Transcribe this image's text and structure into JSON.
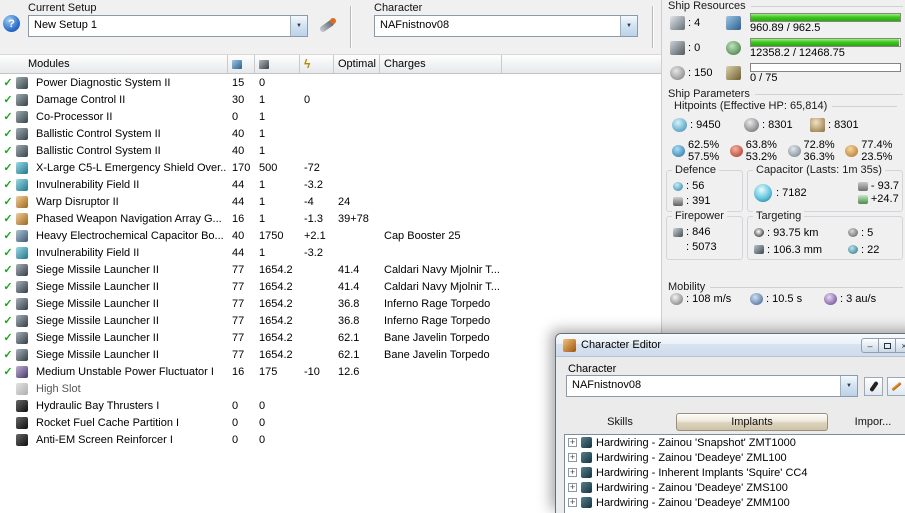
{
  "icons": {
    "help": "?",
    "dropdown_arrow": "▼",
    "check": "✓",
    "lightning": "ϟ",
    "expand": "+",
    "minimize": "–",
    "close": "×"
  },
  "toolbar": {
    "current_setup_label": "Current Setup",
    "setup_value": "New Setup 1",
    "character_label": "Character",
    "character_value": "NAFnistnov08"
  },
  "modules": {
    "title": "Modules",
    "optimal_header": "Optimal",
    "charges_header": "Charges",
    "rows": [
      {
        "check": true,
        "icon": "module",
        "name": "Power Diagnostic System II",
        "cpu": "15",
        "pg": "0",
        "cap": "",
        "optimal": "",
        "charges": ""
      },
      {
        "check": true,
        "icon": "module",
        "name": "Damage Control II",
        "cpu": "30",
        "pg": "1",
        "cap": "0",
        "optimal": "",
        "charges": ""
      },
      {
        "check": true,
        "icon": "module",
        "name": "Co-Processor II",
        "cpu": "0",
        "pg": "1",
        "cap": "",
        "optimal": "",
        "charges": ""
      },
      {
        "check": true,
        "icon": "module",
        "name": "Ballistic Control System II",
        "cpu": "40",
        "pg": "1",
        "cap": "",
        "optimal": "",
        "charges": ""
      },
      {
        "check": true,
        "icon": "module",
        "name": "Ballistic Control System II",
        "cpu": "40",
        "pg": "1",
        "cap": "",
        "optimal": "",
        "charges": ""
      },
      {
        "check": true,
        "icon": "shield",
        "name": "X-Large C5-L Emergency Shield Over...",
        "cpu": "170",
        "pg": "500",
        "cap": "-72",
        "optimal": "",
        "charges": ""
      },
      {
        "check": true,
        "icon": "shield",
        "name": "Invulnerability Field II",
        "cpu": "44",
        "pg": "1",
        "cap": "-3.2",
        "optimal": "",
        "charges": ""
      },
      {
        "check": true,
        "icon": "ewar",
        "name": "Warp Disruptor II",
        "cpu": "44",
        "pg": "1",
        "cap": "-4",
        "optimal": "24",
        "charges": ""
      },
      {
        "check": true,
        "icon": "ewar",
        "name": "Phased Weapon Navigation Array G...",
        "cpu": "16",
        "pg": "1",
        "cap": "-1.3",
        "optimal": "39+78",
        "charges": ""
      },
      {
        "check": true,
        "icon": "booster",
        "name": "Heavy Electrochemical Capacitor Bo...",
        "cpu": "40",
        "pg": "1750",
        "cap": "+2.1",
        "optimal": "",
        "charges": "Cap Booster 25"
      },
      {
        "check": true,
        "icon": "shield",
        "name": "Invulnerability Field II",
        "cpu": "44",
        "pg": "1",
        "cap": "-3.2",
        "optimal": "",
        "charges": ""
      },
      {
        "check": true,
        "icon": "launcher",
        "name": "Siege Missile Launcher II",
        "cpu": "77",
        "pg": "1654.2",
        "cap": "",
        "optimal": "41.4",
        "charges": "Caldari Navy Mjolnir T..."
      },
      {
        "check": true,
        "icon": "launcher",
        "name": "Siege Missile Launcher II",
        "cpu": "77",
        "pg": "1654.2",
        "cap": "",
        "optimal": "41.4",
        "charges": "Caldari Navy Mjolnir T..."
      },
      {
        "check": true,
        "icon": "launcher",
        "name": "Siege Missile Launcher II",
        "cpu": "77",
        "pg": "1654.2",
        "cap": "",
        "optimal": "36.8",
        "charges": "Inferno Rage Torpedo"
      },
      {
        "check": true,
        "icon": "launcher",
        "name": "Siege Missile Launcher II",
        "cpu": "77",
        "pg": "1654.2",
        "cap": "",
        "optimal": "36.8",
        "charges": "Inferno Rage Torpedo"
      },
      {
        "check": true,
        "icon": "launcher",
        "name": "Siege Missile Launcher II",
        "cpu": "77",
        "pg": "1654.2",
        "cap": "",
        "optimal": "62.1",
        "charges": "Bane Javelin Torpedo"
      },
      {
        "check": true,
        "icon": "launcher",
        "name": "Siege Missile Launcher II",
        "cpu": "77",
        "pg": "1654.2",
        "cap": "",
        "optimal": "62.1",
        "charges": "Bane Javelin Torpedo"
      },
      {
        "check": true,
        "icon": "nos",
        "name": "Medium Unstable Power Fluctuator I",
        "cpu": "16",
        "pg": "175",
        "cap": "-10",
        "optimal": "12.6",
        "charges": ""
      },
      {
        "check": false,
        "icon": "empty",
        "name": "High Slot",
        "cpu": "",
        "pg": "",
        "cap": "",
        "optimal": "",
        "charges": ""
      },
      {
        "check": false,
        "icon": "rig",
        "name": "Hydraulic Bay Thrusters I",
        "cpu": "0",
        "pg": "0",
        "cap": "",
        "optimal": "",
        "charges": ""
      },
      {
        "check": false,
        "icon": "rig",
        "name": "Rocket Fuel Cache Partition I",
        "cpu": "0",
        "pg": "0",
        "cap": "",
        "optimal": "",
        "charges": ""
      },
      {
        "check": false,
        "icon": "rig",
        "name": "Anti-EM Screen Reinforcer I",
        "cpu": "0",
        "pg": "0",
        "cap": "",
        "optimal": "",
        "charges": ""
      }
    ]
  },
  "ship_resources": {
    "title": "Ship Resources",
    "turret_hardpoints": "4",
    "launcher_hardpoints": "0",
    "calibration": "150",
    "cpu": {
      "text": "960.89 / 962.5",
      "pct": 99.8
    },
    "powergrid": {
      "text": "12358.2 / 12468.75",
      "pct": 99.1
    },
    "upgrades": {
      "text": "0 / 75",
      "pct": 0
    }
  },
  "ship_parameters": {
    "title": "Ship Parameters",
    "hitpoints_title": "Hitpoints (Effective HP: 65,814)",
    "shield_hp": "9450",
    "armor_hp": "8301",
    "hull_hp": "8301",
    "resists": [
      {
        "shield": "62.5%",
        "armor": "57.5%"
      },
      {
        "shield": "63.8%",
        "armor": "53.2%"
      },
      {
        "shield": "72.8%",
        "armor": "36.3%"
      },
      {
        "shield": "77.4%",
        "armor": "23.5%"
      }
    ],
    "defence": {
      "title": "Defence",
      "shield_recharge": "56",
      "armor_value": "391"
    },
    "capacitor": {
      "title": "Capacitor (Lasts: 1m 35s)",
      "amount": "7182",
      "drain": "- 93.7",
      "recharge": "+24.7"
    },
    "firepower": {
      "title": "Firepower",
      "volley": "846",
      "dps": "5073"
    },
    "targeting": {
      "title": "Targeting",
      "range": "93.75 km",
      "max_targets": "5",
      "scan_resolution": "106.3 mm",
      "sensor_strength": "22"
    },
    "mobility": {
      "title": "Mobility",
      "speed": "108 m/s",
      "align_time": "10.5 s",
      "warp_speed": "3 au/s"
    }
  },
  "character_editor": {
    "title": "Character Editor",
    "character_label": "Character",
    "character_value": "NAFnistnov08",
    "tabs": [
      "Skills",
      "Implants",
      "Impor..."
    ],
    "active_tab": "Implants",
    "implants": [
      "Hardwiring - Zainou 'Snapshot' ZMT1000",
      "Hardwiring - Zainou 'Deadeye' ZML100",
      "Hardwiring - Inherent Implants 'Squire' CC4",
      "Hardwiring - Zainou 'Deadeye' ZMS100",
      "Hardwiring - Zainou 'Deadeye' ZMM100"
    ]
  }
}
